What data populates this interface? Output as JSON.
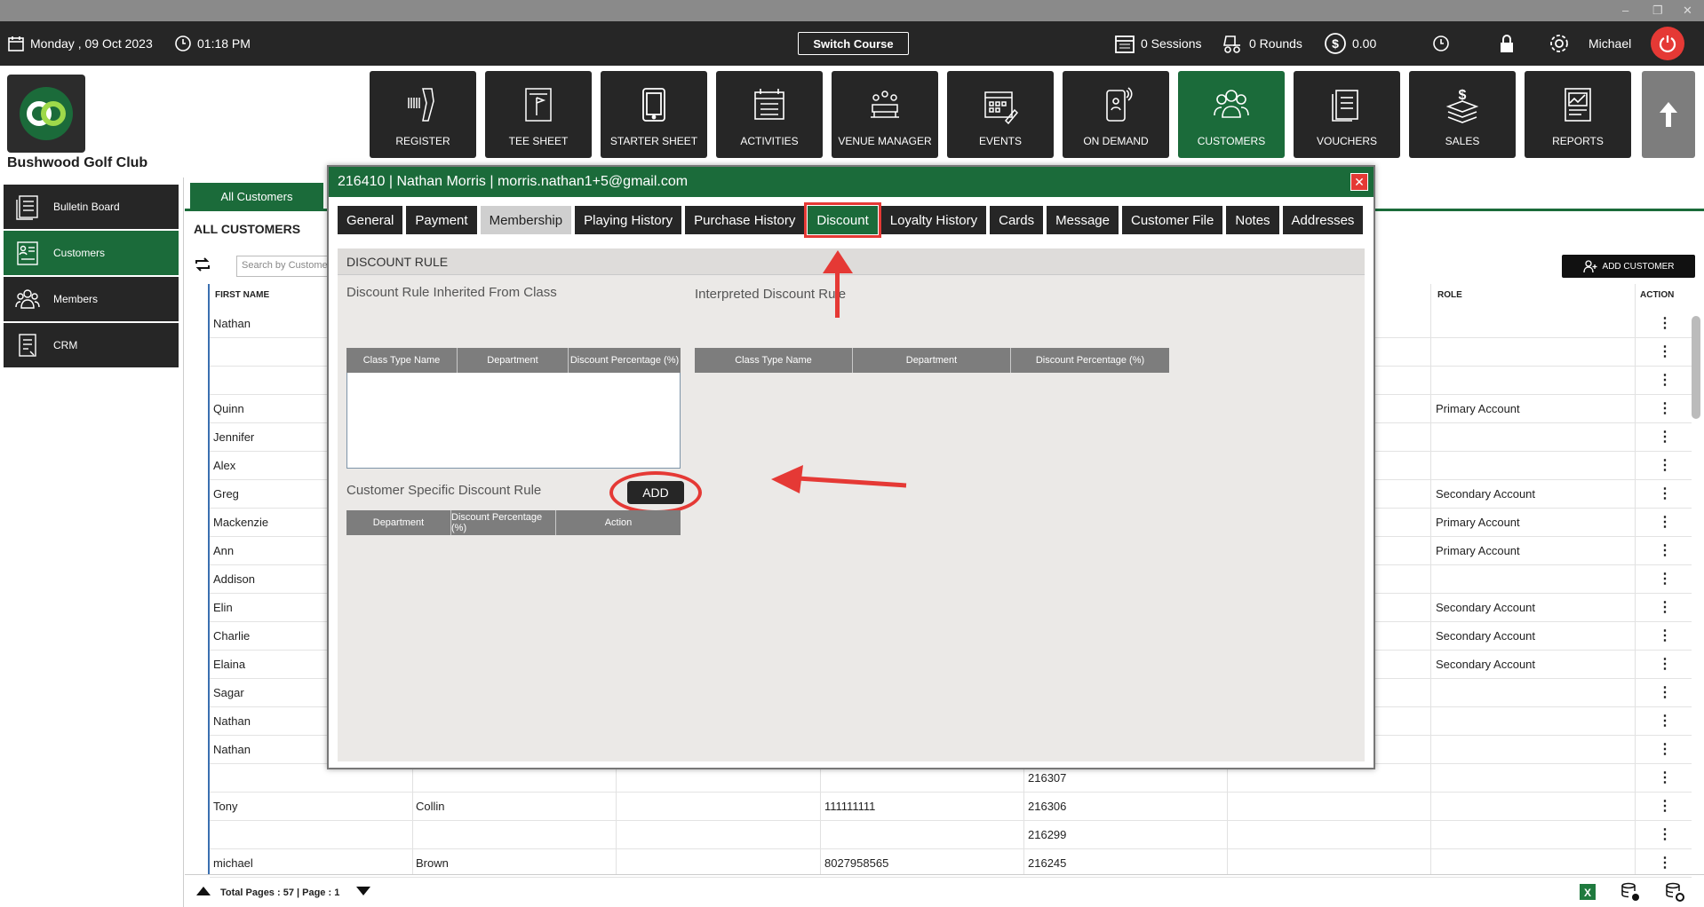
{
  "topbar": {
    "date": "Monday ,  09 Oct 2023",
    "time": "01:18 PM",
    "switch_course": "Switch Course",
    "sessions": "0 Sessions",
    "rounds": "0 Rounds",
    "balance": "0.00",
    "user": "Michael"
  },
  "club": {
    "name": "Bushwood Golf Club"
  },
  "nav": [
    {
      "label": "REGISTER",
      "icon": "barcode-scanner-icon"
    },
    {
      "label": "TEE SHEET",
      "icon": "tee-sheet-icon"
    },
    {
      "label": "STARTER SHEET",
      "icon": "tablet-icon"
    },
    {
      "label": "ACTIVITIES",
      "icon": "activities-icon"
    },
    {
      "label": "VENUE MANAGER",
      "icon": "venue-icon"
    },
    {
      "label": "EVENTS",
      "icon": "events-icon"
    },
    {
      "label": "ON DEMAND",
      "icon": "phone-icon"
    },
    {
      "label": "CUSTOMERS",
      "icon": "customers-icon",
      "active": true
    },
    {
      "label": "VOUCHERS",
      "icon": "vouchers-icon"
    },
    {
      "label": "SALES",
      "icon": "sales-icon"
    },
    {
      "label": "REPORTS",
      "icon": "reports-icon"
    }
  ],
  "sidebar": {
    "items": [
      {
        "label": "Bulletin Board"
      },
      {
        "label": "Customers",
        "active": true
      },
      {
        "label": "Members"
      },
      {
        "label": "CRM"
      }
    ]
  },
  "main": {
    "tab": "All Customers",
    "title": "ALL CUSTOMERS",
    "search_placeholder": "Search by Customer",
    "add_customer": "ADD CUSTOMER",
    "headers": {
      "first_name": "FIRST NAME",
      "role": "ROLE",
      "action": "ACTION"
    },
    "rows": [
      {
        "first": "Nathan",
        "last": "",
        "phone": "",
        "id": "",
        "role": ""
      },
      {
        "first": "",
        "last": "",
        "phone": "",
        "id": "",
        "role": ""
      },
      {
        "first": "",
        "last": "",
        "phone": "",
        "id": "",
        "role": ""
      },
      {
        "first": "Quinn",
        "last": "",
        "phone": "",
        "id": "",
        "role": "Primary Account"
      },
      {
        "first": "Jennifer",
        "last": "",
        "phone": "",
        "id": "",
        "role": ""
      },
      {
        "first": "Alex",
        "last": "",
        "phone": "",
        "id": "",
        "role": ""
      },
      {
        "first": "Greg",
        "last": "",
        "phone": "",
        "id": "",
        "role": "Secondary Account"
      },
      {
        "first": "Mackenzie",
        "last": "",
        "phone": "",
        "id": "",
        "role": "Primary Account"
      },
      {
        "first": "Ann",
        "last": "",
        "phone": "",
        "id": "",
        "role": "Primary Account"
      },
      {
        "first": "Addison",
        "last": "",
        "phone": "",
        "id": "",
        "role": ""
      },
      {
        "first": "Elin",
        "last": "",
        "phone": "",
        "id": "",
        "role": "Secondary Account"
      },
      {
        "first": "Charlie",
        "last": "",
        "phone": "",
        "id": "",
        "role": "Secondary Account"
      },
      {
        "first": "Elaina",
        "last": "",
        "phone": "",
        "id": "",
        "role": "Secondary Account"
      },
      {
        "first": "Sagar",
        "last": "",
        "phone": "",
        "id": "",
        "role": ""
      },
      {
        "first": "Nathan",
        "last": "",
        "phone": "",
        "id": "",
        "role": ""
      },
      {
        "first": "Nathan",
        "last": "",
        "phone": "",
        "id": "",
        "role": ""
      },
      {
        "first": "",
        "last": "",
        "phone": "",
        "id": "216307",
        "role": ""
      },
      {
        "first": "Tony",
        "last": "Collin",
        "phone": "111111111",
        "id": "216306",
        "role": ""
      },
      {
        "first": "",
        "last": "",
        "phone": "",
        "id": "216299",
        "role": ""
      },
      {
        "first": "michael",
        "last": "Brown",
        "phone": "8027958565",
        "id": "216245",
        "role": ""
      }
    ],
    "action_glyph": "⋮",
    "footer": "Total Pages : 57 | Page : 1"
  },
  "modal": {
    "title": "216410 | Nathan Morris | morris.nathan1+5@gmail.com",
    "tabs": [
      {
        "label": "General"
      },
      {
        "label": "Payment"
      },
      {
        "label": "Membership",
        "style": "light"
      },
      {
        "label": "Playing History"
      },
      {
        "label": "Purchase History"
      },
      {
        "label": "Discount",
        "style": "discount"
      },
      {
        "label": "Loyalty History"
      },
      {
        "label": "Cards"
      },
      {
        "label": "Message"
      },
      {
        "label": "Customer File"
      },
      {
        "label": "Notes"
      },
      {
        "label": "Addresses"
      }
    ],
    "section_title": "DISCOUNT RULE",
    "inherited": {
      "title": "Discount Rule Inherited From Class",
      "cols": [
        "Class Type Name",
        "Department",
        "Discount Percentage (%)"
      ]
    },
    "interpreted": {
      "title": "Interpreted Discount Rule",
      "cols": [
        "Class Type Name",
        "Department",
        "Discount Percentage (%)"
      ]
    },
    "specific": {
      "title": "Customer Specific Discount Rule",
      "add": "ADD",
      "cols": [
        "Department",
        "Discount Percentage (%)",
        "Action"
      ]
    }
  },
  "colors": {
    "brand_green": "#1b6b3a",
    "dark": "#262626",
    "highlight_red": "#e53935"
  }
}
